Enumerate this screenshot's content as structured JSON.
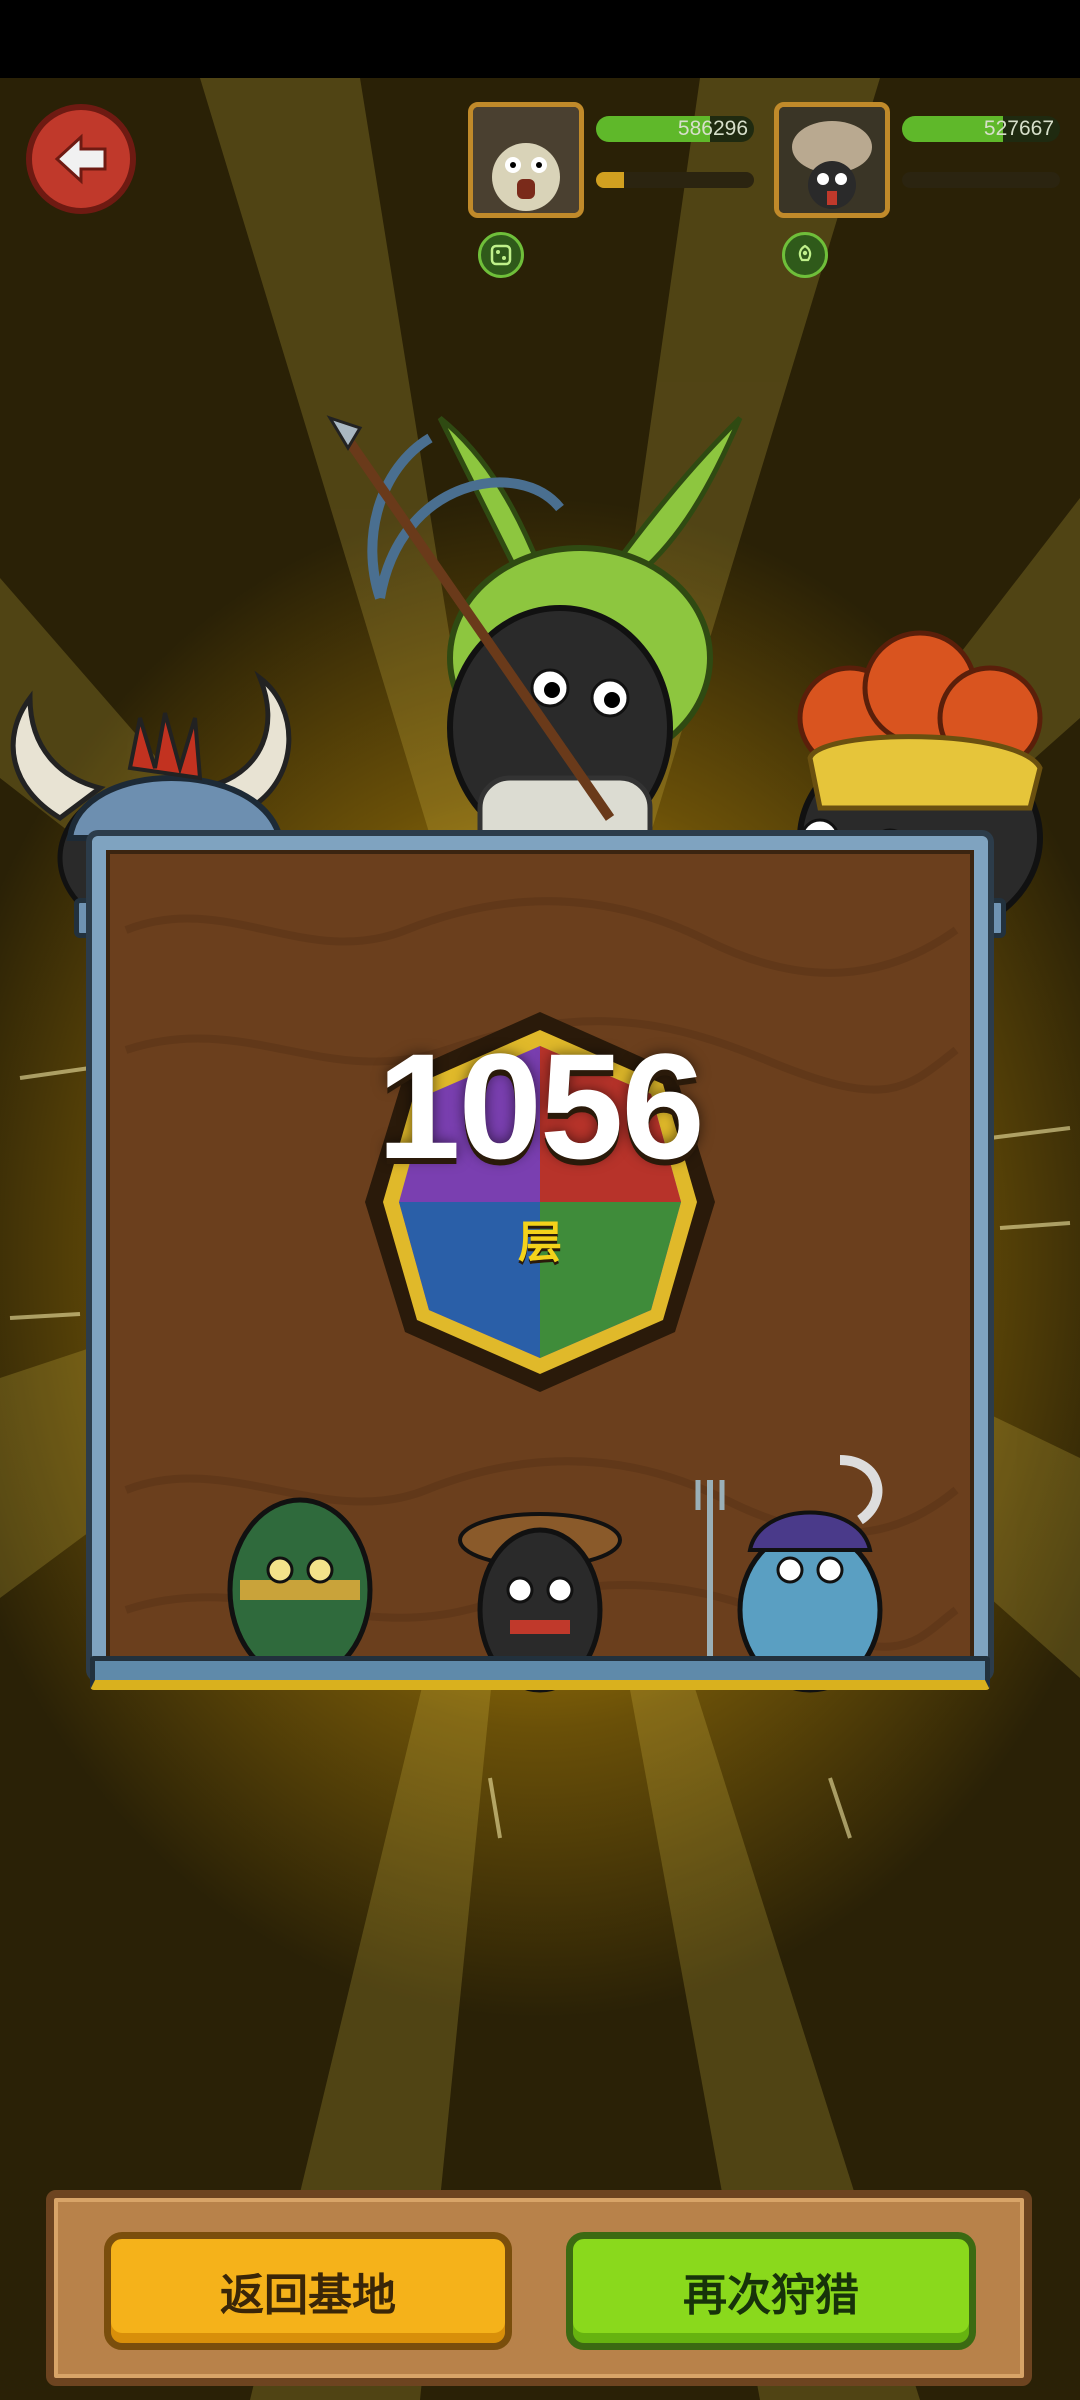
{
  "players": [
    {
      "score": "586296",
      "score_fill": 0.72,
      "sub_fill": 0.18,
      "badge_icon": "dice-icon"
    },
    {
      "score": "527667",
      "score_fill": 0.64,
      "sub_fill": 0.0,
      "badge_icon": "rocket-icon"
    }
  ],
  "floor": {
    "number": "1056",
    "unit": "层"
  },
  "buttons": {
    "return_label": "返回基地",
    "hunt_again_label": "再次狩猎"
  },
  "colors": {
    "accent_orange": "#f5b21a",
    "accent_green": "#8ad91c",
    "back_red": "#c0392b",
    "board_frame": "#7fa3c0"
  }
}
